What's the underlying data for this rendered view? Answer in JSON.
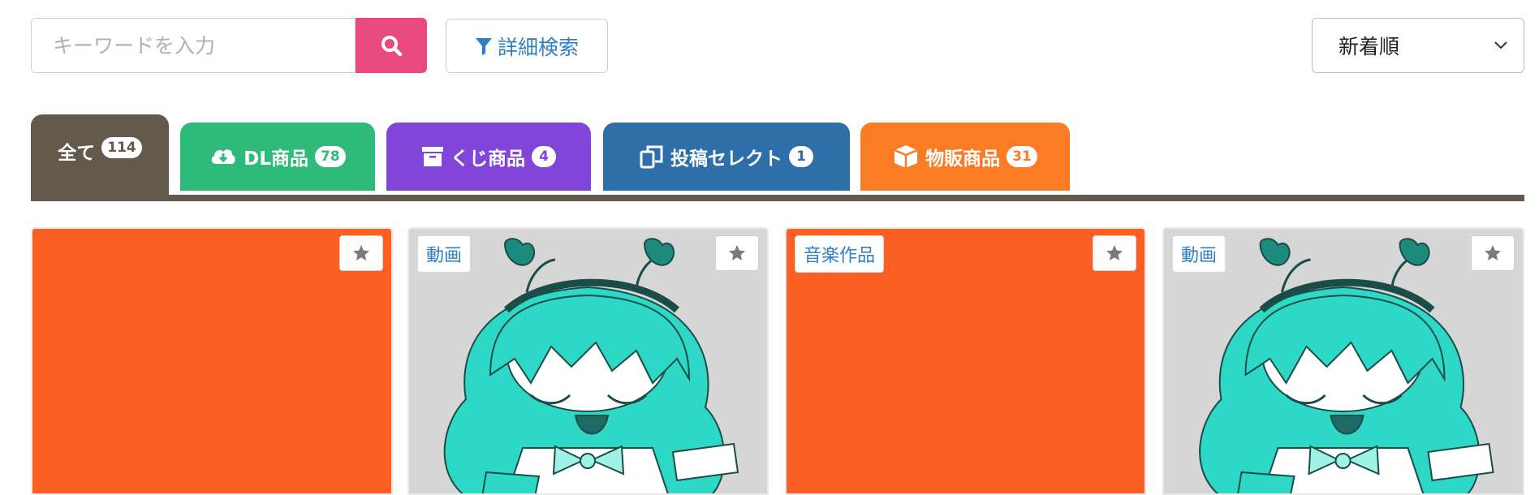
{
  "search": {
    "placeholder": "キーワードを入力",
    "value": ""
  },
  "advanced_search": {
    "label": "詳細検索"
  },
  "sort": {
    "selected": "新着順"
  },
  "tabs": [
    {
      "label": "全て",
      "count": "114",
      "color": "#645a4b",
      "icon": "none"
    },
    {
      "label": "DL商品",
      "count": "78",
      "color": "#2ebb7a",
      "icon": "cloud-download-icon"
    },
    {
      "label": "くじ商品",
      "count": "4",
      "color": "#8146d9",
      "icon": "archive-box-icon"
    },
    {
      "label": "投稿セレクト",
      "count": "1",
      "color": "#2f6fa9",
      "icon": "copy-icon"
    },
    {
      "label": "物販商品",
      "count": "31",
      "color": "#fb7c24",
      "icon": "cube-icon"
    }
  ],
  "cards": [
    {
      "category": "",
      "thumbnail": "orange",
      "favorite_icon": "star-icon"
    },
    {
      "category": "動画",
      "thumbnail": "teal-character",
      "favorite_icon": "star-icon"
    },
    {
      "category": "音楽作品",
      "thumbnail": "orange",
      "favorite_icon": "star-icon"
    },
    {
      "category": "動画",
      "thumbnail": "teal-character",
      "favorite_icon": "star-icon"
    }
  ],
  "colors": {
    "accent_pink": "#e94b81",
    "link_blue": "#2f7fc4",
    "thumb_orange": "#fc5f22",
    "thumb_gray": "#d6d6d6"
  }
}
